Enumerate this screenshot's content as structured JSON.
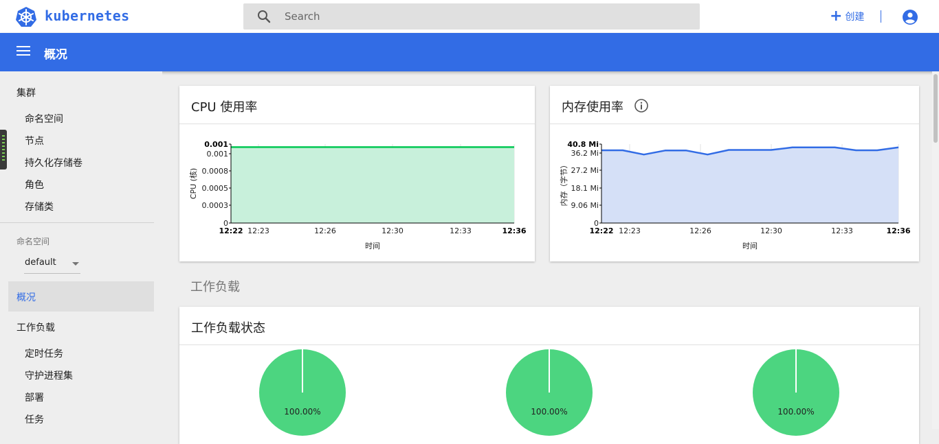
{
  "header": {
    "brand": "kubernetes",
    "search_placeholder": "Search",
    "create_label": "创建",
    "brand_color": "#326ce5"
  },
  "titlebar": {
    "title": "概况"
  },
  "sidebar": {
    "cluster_heading": "集群",
    "cluster_items": [
      "命名空间",
      "节点",
      "持久化存储卷",
      "角色",
      "存储类"
    ],
    "namespace_caption": "命名空间",
    "namespace_value": "default",
    "active_item": "概况",
    "workloads_heading": "工作负载",
    "workload_items": [
      "定时任务",
      "守护进程集",
      "部署",
      "任务"
    ]
  },
  "main": {
    "cpu_card_title": "CPU 使用率",
    "mem_card_title": "内存使用率",
    "section_workloads": "工作负载",
    "workload_status_title": "工作负载状态",
    "pies": [
      {
        "label": "100.00%",
        "value": 100,
        "color": "#4cd580"
      },
      {
        "label": "100.00%",
        "value": 100,
        "color": "#4cd580"
      },
      {
        "label": "100.00%",
        "value": 100,
        "color": "#4cd580"
      }
    ]
  },
  "chart_data": [
    {
      "type": "area",
      "ylabel": "CPU (核)",
      "xlabel": "时间",
      "x_ticks": [
        "12:22",
        "12:23",
        "12:26",
        "12:30",
        "12:33",
        "12:36"
      ],
      "x_ticks_bold": [
        true,
        false,
        false,
        false,
        false,
        true
      ],
      "y_ticks": [
        "0",
        "0.0003",
        "0.0005",
        "0.0008",
        "0.001",
        "0.001"
      ],
      "y_ticks_bold": [
        false,
        false,
        false,
        false,
        false,
        true
      ],
      "values": [
        0.001,
        0.001,
        0.001,
        0.001,
        0.001,
        0.001,
        0.001,
        0.001,
        0.001,
        0.001,
        0.001,
        0.001,
        0.001,
        0.001,
        0.001
      ],
      "ylim": [
        0,
        0.00104
      ],
      "color": "#00c752",
      "fill": "#c8f0db"
    },
    {
      "type": "area",
      "ylabel": "内存（字节）",
      "xlabel": "时间",
      "x_ticks": [
        "12:22",
        "12:23",
        "12:26",
        "12:30",
        "12:33",
        "12:36"
      ],
      "x_ticks_bold": [
        true,
        false,
        false,
        false,
        false,
        true
      ],
      "y_ticks": [
        "0",
        "9.06 Mi",
        "18.1 Mi",
        "27.2 Mi",
        "36.2 Mi",
        "40.8 Mi"
      ],
      "y_ticks_bold": [
        false,
        false,
        false,
        false,
        false,
        true
      ],
      "values": [
        37.6,
        37.6,
        35.4,
        37.5,
        37.5,
        35.4,
        37.8,
        37.8,
        37.8,
        39.1,
        39.1,
        39.1,
        37.6,
        37.6,
        39.1
      ],
      "ylim": [
        0,
        40.8
      ],
      "color": "#326ce5",
      "fill": "#d5e0f7"
    }
  ]
}
